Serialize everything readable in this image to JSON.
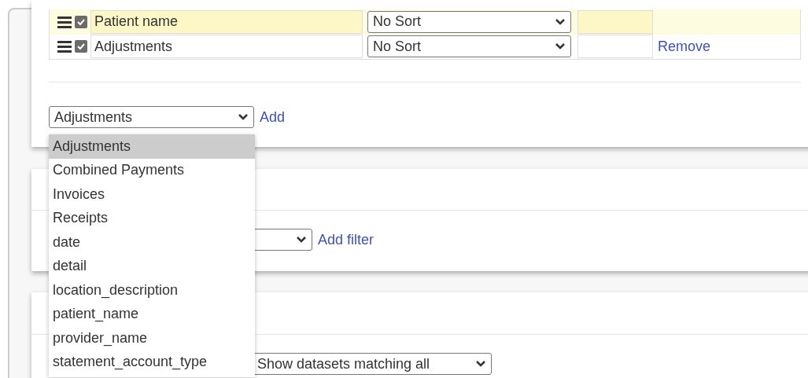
{
  "columns_section": {
    "rows": [
      {
        "label": "Patient name",
        "checked": true,
        "selected": true,
        "sort": "No Sort",
        "action": null
      },
      {
        "label": "Adjustments",
        "checked": true,
        "selected": false,
        "sort": "No Sort",
        "action": "Remove"
      }
    ],
    "add_select": {
      "value": "Adjustments",
      "expanded": true,
      "options": [
        {
          "label": "Adjustments",
          "selected": true
        },
        {
          "label": "Combined Payments",
          "selected": false
        },
        {
          "label": "Invoices",
          "selected": false
        },
        {
          "label": "Receipts",
          "selected": false
        },
        {
          "label": "date",
          "selected": false
        },
        {
          "label": "detail",
          "selected": false
        },
        {
          "label": "location_description",
          "selected": false
        },
        {
          "label": "patient_name",
          "selected": false
        },
        {
          "label": "provider_name",
          "selected": false
        },
        {
          "label": "statement_account_type",
          "selected": false
        }
      ]
    },
    "add_link": "Add"
  },
  "filters_section": {
    "add_link": "Add filter"
  },
  "datasets_section": {
    "match_select": "Show datasets matching all"
  }
}
